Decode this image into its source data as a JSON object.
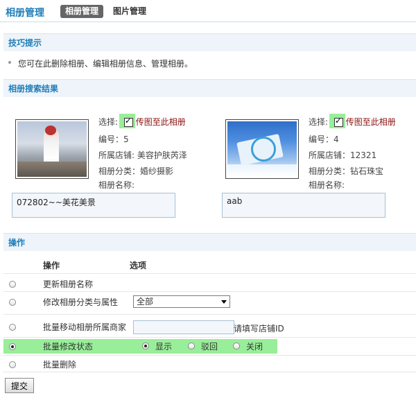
{
  "header": {
    "title": "相册管理",
    "tabs": [
      "相册管理",
      "图片管理"
    ]
  },
  "tips": {
    "title": "技巧提示",
    "text": "您可在此删除相册、编辑相册信息、管理相册。"
  },
  "results": {
    "title": "相册搜索结果",
    "albums": [
      {
        "select_label": "选择:",
        "upload_link": "传图至此相册",
        "number": "编号：5",
        "shop": "所属店铺: 美容护肤芮泽",
        "category": "相册分类：婚纱摄影",
        "name_label": "相册名称:",
        "name_value": "072802~~美花美景"
      },
      {
        "select_label": "选择:",
        "upload_link": "传图至此相册",
        "number": "编号：4",
        "shop": "所属店铺：12321",
        "category": "相册分类：钻石珠宝",
        "name_label": "相册名称:",
        "name_value": "aab"
      }
    ]
  },
  "operations": {
    "title": "操作",
    "col_action": "操作",
    "col_options": "选项",
    "rows": [
      {
        "label": "更新相册名称"
      },
      {
        "label": "修改相册分类与属性",
        "select_value": "全部"
      },
      {
        "label": "批量移动相册所属商家",
        "hint": "请填写店铺ID"
      },
      {
        "label": "批量修改状态",
        "options": [
          "显示",
          "驳回",
          "关闭"
        ],
        "selected": "显示"
      },
      {
        "label": "批量删除"
      }
    ],
    "selected_row": 3,
    "submit_label": "提交"
  },
  "colors": {
    "accent": "#1f7db8",
    "highlight": "#99ee99",
    "link": "#8b1010"
  }
}
